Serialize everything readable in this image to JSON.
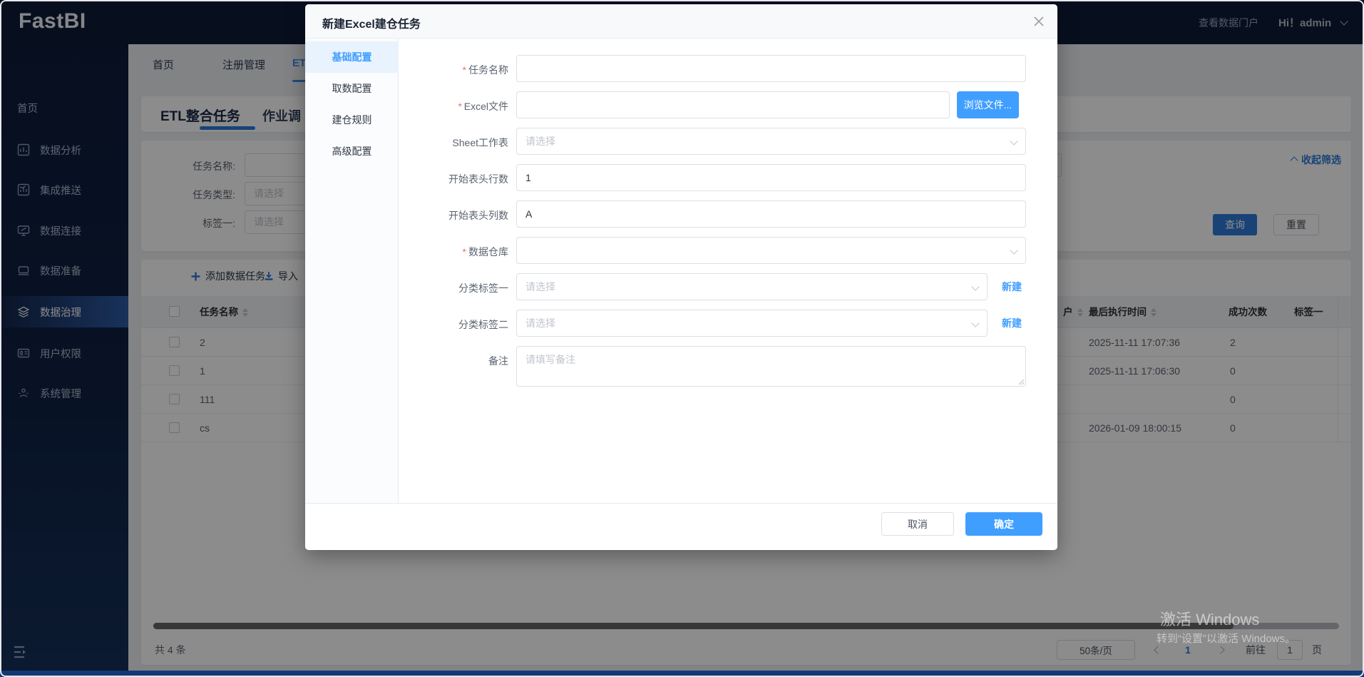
{
  "topbar": {
    "logo": "FastBI",
    "portal_link": "查看数据门户",
    "user_greeting": "Hi！admin"
  },
  "sidebar": {
    "items": [
      {
        "label": "首页",
        "icon": "none",
        "active": false
      },
      {
        "label": "数据分析",
        "icon": "bar-chart-icon",
        "active": false
      },
      {
        "label": "集成推送",
        "icon": "push-chart-icon",
        "active": false
      },
      {
        "label": "数据连接",
        "icon": "monitor-icon",
        "active": false
      },
      {
        "label": "数据准备",
        "icon": "laptop-icon",
        "active": false
      },
      {
        "label": "数据治理",
        "icon": "layers-icon",
        "active": true
      },
      {
        "label": "用户权限",
        "icon": "id-card-icon",
        "active": false
      },
      {
        "label": "系统管理",
        "icon": "settings-icon",
        "active": false
      }
    ]
  },
  "tabs": {
    "items": [
      "首页",
      "注册管理",
      "ET"
    ],
    "active_index": 2
  },
  "page": {
    "title_active": "ETL整合任务",
    "title_secondary": "作业调"
  },
  "filters": {
    "rows": [
      {
        "label": "任务名称:",
        "placeholder": ""
      },
      {
        "label": "任务类型:",
        "placeholder": "请选择"
      },
      {
        "label": "标签一:",
        "placeholder": "请选择"
      }
    ],
    "collapse_label": "收起筛选",
    "search_label": "查询",
    "reset_label": "重置"
  },
  "toolbar": {
    "add_label": "添加数据任务",
    "import_label": "导入"
  },
  "table": {
    "columns": {
      "name": "任务名称",
      "partial_user": "户",
      "last_run": "最后执行时间",
      "success": "成功次数",
      "tag": "标签一"
    },
    "rows": [
      {
        "name": "2",
        "last_run": "2025-11-11 17:07:36",
        "success": "2"
      },
      {
        "name": "1",
        "last_run": "2025-11-11 17:06:30",
        "success": "0"
      },
      {
        "name": "111",
        "last_run": "",
        "success": "0"
      },
      {
        "name": "cs",
        "last_run": "2026-01-09 18:00:15",
        "success": "0"
      }
    ]
  },
  "footer": {
    "total": "共 4 条",
    "page_size": "50条/页",
    "current_page": "1",
    "goto_label": "前往",
    "goto_value": "1",
    "page_unit": "页"
  },
  "modal": {
    "title": "新建Excel建仓任务",
    "required_mark": "*",
    "tabs": [
      "基础配置",
      "取数配置",
      "建仓规则",
      "高级配置"
    ],
    "active_tab_index": 0,
    "fields": {
      "task_name": {
        "label": "任务名称",
        "value": ""
      },
      "excel_file": {
        "label": "Excel文件",
        "value": "",
        "browse_label": "浏览文件..."
      },
      "sheet": {
        "label": "Sheet工作表",
        "placeholder": "请选择"
      },
      "header_row": {
        "label": "开始表头行数",
        "value": "1"
      },
      "header_col": {
        "label": "开始表头列数",
        "value": "A"
      },
      "warehouse": {
        "label": "数据仓库",
        "value": ""
      },
      "tag1": {
        "label": "分类标签一",
        "placeholder": "请选择",
        "new_label": "新建"
      },
      "tag2": {
        "label": "分类标签二",
        "placeholder": "请选择",
        "new_label": "新建"
      },
      "remark": {
        "label": "备注",
        "placeholder": "请填写备注"
      }
    },
    "cancel_label": "取消",
    "confirm_label": "确定"
  },
  "watermark": {
    "line1": "激活 Windows",
    "line2": "转到“设置”以激活 Windows。"
  },
  "colors": {
    "primary": "#409EFF",
    "page_primary": "#2f7ad9",
    "sidebar_bg": "#0d1c3a",
    "danger": "#f56c6c"
  }
}
